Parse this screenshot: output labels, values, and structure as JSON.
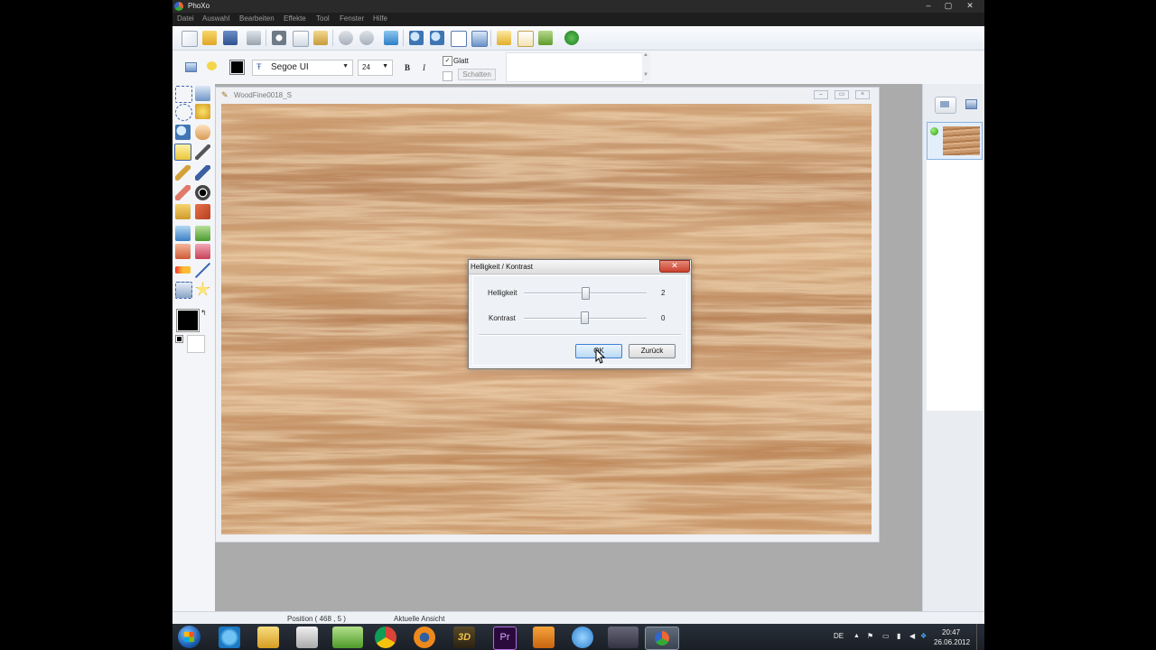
{
  "app": {
    "title": "PhoXo",
    "menu": [
      "Datei",
      "Auswahl",
      "Bearbeiten",
      "Effekte",
      "Tool",
      "Fenster",
      "Hilfe"
    ],
    "window_controls": {
      "minimize": "‒",
      "maximize": "▢",
      "close": "✕"
    }
  },
  "toolbar2": {
    "font": "Segoe UI",
    "font_size": "24",
    "bold": "B",
    "italic": "I",
    "smooth_label": "Glatt",
    "smooth_checked": "✓",
    "shadow_label": "Schatten",
    "color": "#000000"
  },
  "document": {
    "title": "WoodFine0018_S"
  },
  "dialog": {
    "title": "Helligkeit / Kontrast",
    "close": "✕",
    "brightness_label": "Helligkeit",
    "brightness_value": "2",
    "contrast_label": "Kontrast",
    "contrast_value": "0",
    "ok": "OK",
    "back": "Zurück"
  },
  "status": {
    "position": "Position ( 468 , 5 )",
    "view": "Aktuelle Ansicht"
  },
  "taskbar": {
    "language": "DE",
    "time": "20:47",
    "date": "26.06.2012",
    "premiere_label": "Pr",
    "threed_label": "3D"
  },
  "colors": {
    "accent": "#3c7fd8",
    "foreground": "#000000",
    "background": "#ffffff",
    "dialog_close": "#c9412c"
  }
}
